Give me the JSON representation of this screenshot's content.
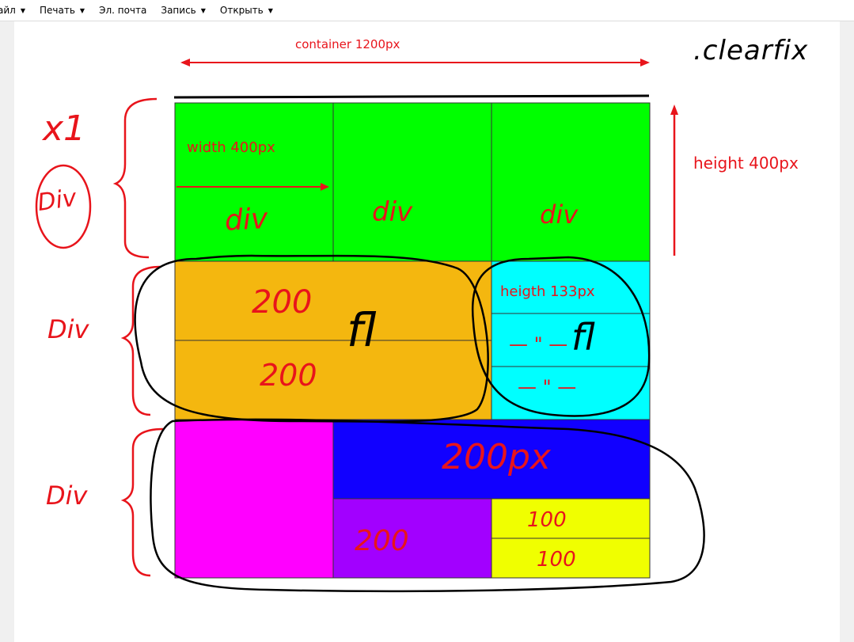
{
  "toolbar": {
    "items": [
      {
        "label": "айл",
        "icon": "chevron-down-icon"
      },
      {
        "label": "Печать",
        "icon": "chevron-down-icon"
      },
      {
        "label": "Эл. почта",
        "icon": ""
      },
      {
        "label": "Запись",
        "icon": "chevron-down-icon"
      },
      {
        "label": "Открыть",
        "icon": "chevron-down-icon"
      }
    ]
  },
  "annotations": {
    "container_label": "container 1200px",
    "width_label": "width 400px",
    "height_label": "height 400px",
    "heigth_label": "heigth 133px",
    "clearfix": ".clearfix",
    "x1": "x1",
    "div": "Div",
    "div_lower": "div",
    "n200": "200",
    "n200px": "200px",
    "n100": "100",
    "fl": "fl",
    "ditto": "— \" —"
  },
  "colors": {
    "green": "#00ff00",
    "orange": "#f4b70f",
    "cyan": "#00ffff",
    "magenta": "#ff00ff",
    "blue": "#1100ff",
    "purple": "#a200ff",
    "yellow": "#f0ff00",
    "red_ink": "#e8141b",
    "black_ink": "#000000"
  }
}
